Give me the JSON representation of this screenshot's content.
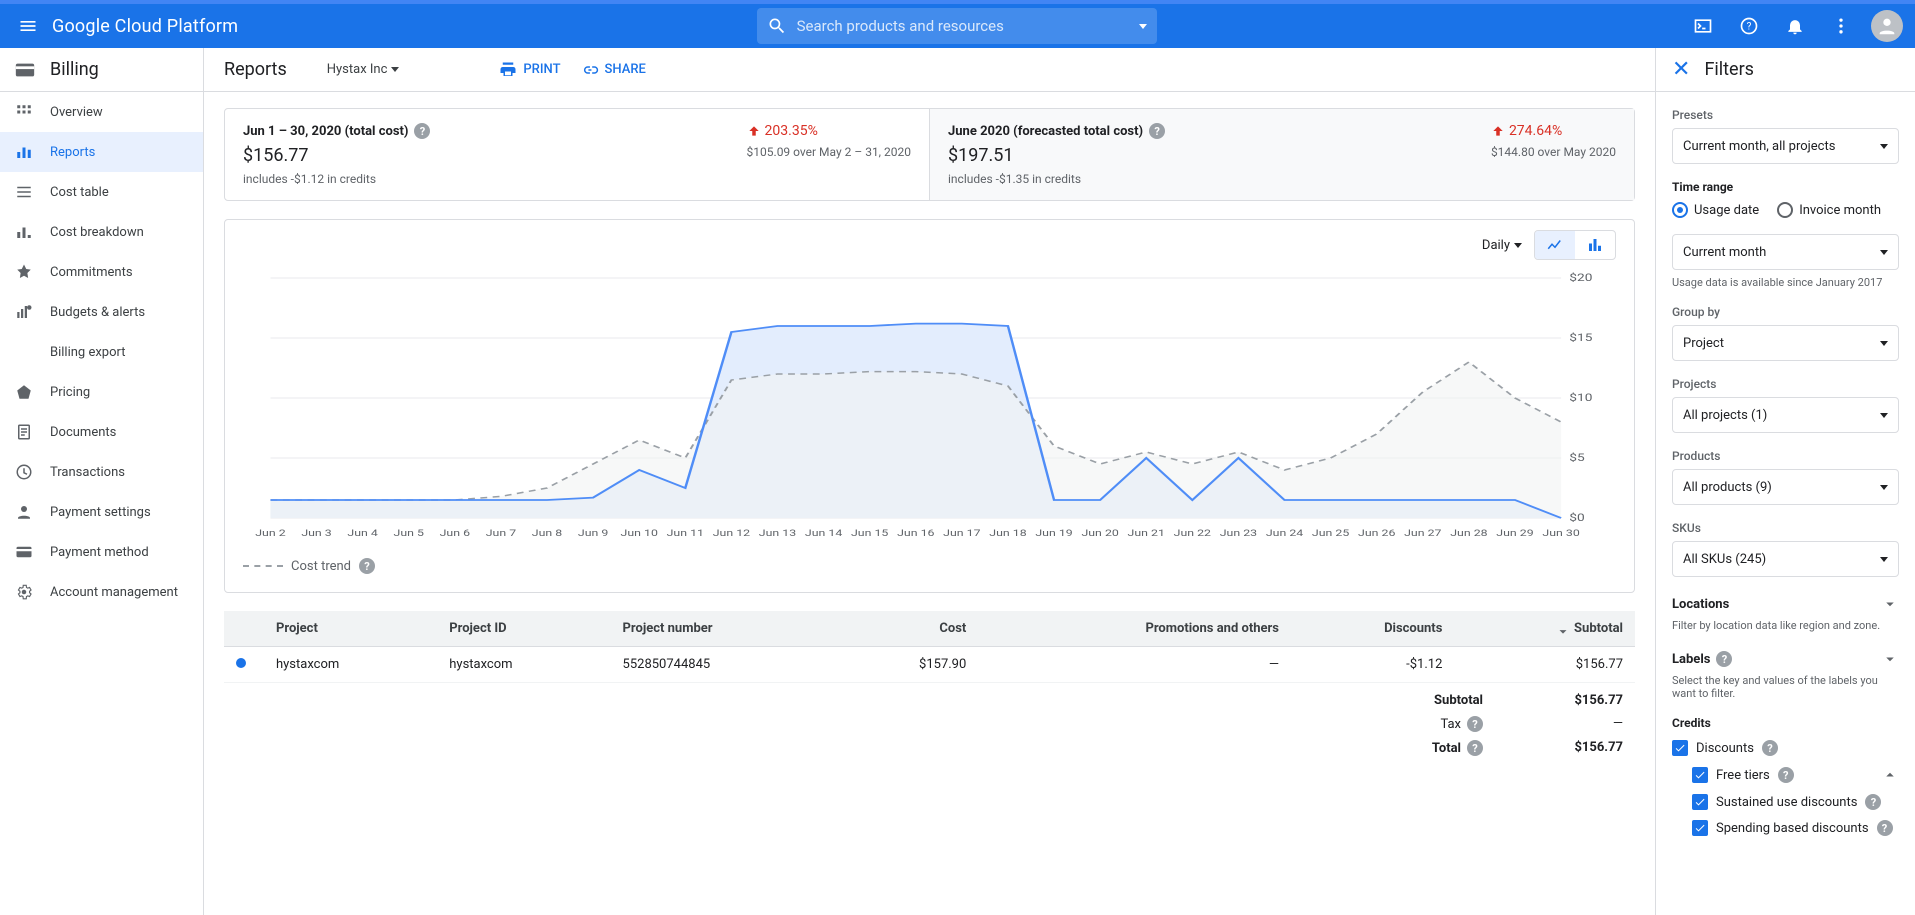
{
  "header": {
    "product_name": "Google Cloud Platform",
    "search_placeholder": "Search products and resources"
  },
  "section": {
    "name": "Billing",
    "nav": [
      {
        "label": "Overview"
      },
      {
        "label": "Reports"
      },
      {
        "label": "Cost table"
      },
      {
        "label": "Cost breakdown"
      },
      {
        "label": "Commitments"
      },
      {
        "label": "Budgets & alerts"
      },
      {
        "label": "Billing export"
      },
      {
        "label": "Pricing"
      },
      {
        "label": "Documents"
      },
      {
        "label": "Transactions"
      },
      {
        "label": "Payment settings"
      },
      {
        "label": "Payment method"
      },
      {
        "label": "Account management"
      }
    ]
  },
  "page": {
    "title": "Reports",
    "org": "Hystax Inc",
    "actions": {
      "print": "PRINT",
      "share": "SHARE"
    }
  },
  "summary": {
    "left": {
      "title": "Jun 1 – 30, 2020 (total cost)",
      "value": "$156.77",
      "credits": "includes -$1.12 in credits",
      "delta": "203.35%",
      "delta_sub": "$105.09 over May 2 – 31, 2020"
    },
    "right": {
      "title": "June 2020 (forecasted total cost)",
      "value": "$197.51",
      "credits": "includes -$1.35 in credits",
      "delta": "274.64%",
      "delta_sub": "$144.80 over May 2020"
    }
  },
  "chart_toolbar": {
    "grain": "Daily"
  },
  "chart_data": {
    "type": "line",
    "title": "",
    "xlabel": "",
    "ylabel": "",
    "ylim": [
      0,
      20
    ],
    "yticks": [
      "$0",
      "$5",
      "$10",
      "$15",
      "$20"
    ],
    "categories": [
      "Jun 2",
      "Jun 3",
      "Jun 4",
      "Jun 5",
      "Jun 6",
      "Jun 7",
      "Jun 8",
      "Jun 9",
      "Jun 10",
      "Jun 11",
      "Jun 12",
      "Jun 13",
      "Jun 14",
      "Jun 15",
      "Jun 16",
      "Jun 17",
      "Jun 18",
      "Jun 19",
      "Jun 20",
      "Jun 21",
      "Jun 22",
      "Jun 23",
      "Jun 24",
      "Jun 25",
      "Jun 26",
      "Jun 27",
      "Jun 28",
      "Jun 29",
      "Jun 30"
    ],
    "series": [
      {
        "name": "hystaxcom",
        "style": "solid",
        "color": "#4f8df7",
        "values": [
          1.5,
          1.5,
          1.5,
          1.5,
          1.5,
          1.5,
          1.5,
          1.7,
          4.0,
          2.5,
          15.5,
          16.0,
          16.0,
          16.0,
          16.2,
          16.2,
          16.0,
          1.5,
          1.5,
          5.0,
          1.5,
          5.0,
          1.5,
          1.5,
          1.5,
          1.5,
          1.5,
          1.5,
          0.0
        ]
      },
      {
        "name": "Cost trend",
        "style": "dashed",
        "color": "#9aa0a6",
        "values": [
          1.5,
          1.5,
          1.5,
          1.5,
          1.5,
          1.8,
          2.5,
          4.5,
          6.5,
          5.0,
          11.5,
          12.0,
          12.0,
          12.2,
          12.2,
          12.0,
          11.0,
          6.0,
          4.5,
          5.5,
          4.5,
          5.5,
          4.0,
          5.0,
          7.0,
          10.5,
          13.0,
          10.0,
          8.0
        ]
      }
    ],
    "legend": "Cost trend"
  },
  "table": {
    "columns": [
      "Project",
      "Project ID",
      "Project number",
      "Cost",
      "Promotions and others",
      "Discounts",
      "Subtotal"
    ],
    "sort_col": "Subtotal",
    "rows": [
      {
        "project": "hystaxcom",
        "project_id": "hystaxcom",
        "project_number": "552850744845",
        "cost": "$157.90",
        "promotions": "—",
        "discounts": "-$1.12",
        "subtotal": "$156.77"
      }
    ],
    "totals": {
      "subtotal_label": "Subtotal",
      "subtotal": "$156.77",
      "tax_label": "Tax",
      "tax": "—",
      "total_label": "Total",
      "total": "$156.77"
    }
  },
  "filters": {
    "title": "Filters",
    "presets_label": "Presets",
    "presets_value": "Current month, all projects",
    "time_range_label": "Time range",
    "usage_date": "Usage date",
    "invoice_month": "Invoice month",
    "time_range_value": "Current month",
    "time_range_hint": "Usage data is available since January 2017",
    "group_by_label": "Group by",
    "group_by_value": "Project",
    "projects_label": "Projects",
    "projects_value": "All projects (1)",
    "products_label": "Products",
    "products_value": "All products (9)",
    "skus_label": "SKUs",
    "skus_value": "All SKUs (245)",
    "locations_label": "Locations",
    "locations_hint": "Filter by location data like region and zone.",
    "labels_label": "Labels",
    "labels_hint": "Select the key and values of the labels you want to filter.",
    "credits_label": "Credits",
    "credits": {
      "discounts": "Discounts",
      "free_tiers": "Free tiers",
      "sustained": "Sustained use discounts",
      "spending": "Spending based discounts"
    }
  }
}
